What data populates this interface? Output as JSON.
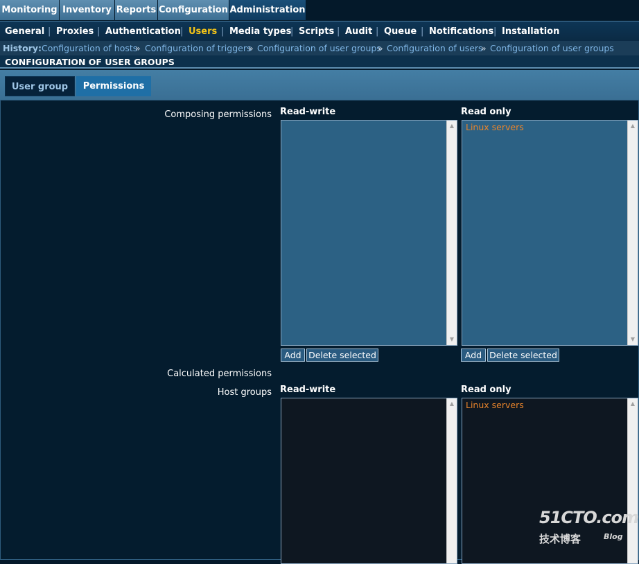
{
  "main_menu": [
    "Monitoring",
    "Inventory",
    "Reports",
    "Configuration",
    "Administration"
  ],
  "sub_menu": [
    "General",
    "Proxies",
    "Authentication",
    "Users",
    "Media types",
    "Scripts",
    "Audit",
    "Queue",
    "Notifications",
    "Installation"
  ],
  "sub_menu_separator": "|",
  "history": {
    "label": "History:",
    "links": [
      "Configuration of hosts",
      "Configuration of triggers",
      "Configuration of user groups",
      "Configuration of users",
      "Configuration of user groups"
    ],
    "separator": "»"
  },
  "page_title": "CONFIGURATION OF USER GROUPS",
  "form_tabs": [
    "User group",
    "Permissions"
  ],
  "form": {
    "composing_label": "Composing permissions",
    "calculated_label": "Calculated permissions",
    "host_groups_label": "Host groups",
    "read_write_label": "Read-write",
    "read_only_label": "Read only",
    "composing_read_only_items": [
      "Linux servers"
    ],
    "calculated_read_only_items": [
      "Linux servers"
    ],
    "add_label": "Add",
    "delete_label": "Delete selected"
  },
  "watermark": {
    "main": "51CTO.com",
    "sub": "技术博客",
    "blog": "Blog"
  },
  "colors": {
    "active_submenu": "#f2c318",
    "list_item": "#e8842b",
    "link": "#7fb6e6"
  },
  "icons": [
    "scroll-up-arrow-icon",
    "scroll-down-arrow-icon"
  ]
}
